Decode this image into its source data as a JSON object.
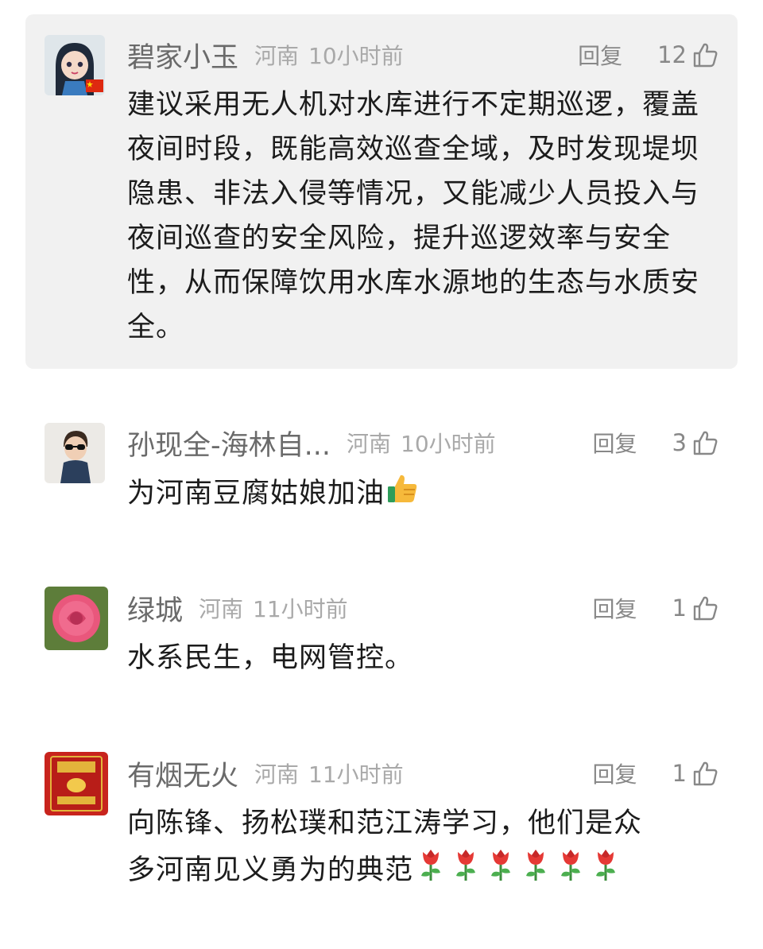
{
  "comments": [
    {
      "username": "碧家小玉",
      "location": "河南",
      "time": "10小时前",
      "reply_label": "回复",
      "likes": "12",
      "text": "建议采用无人机对水库进行不定期巡逻，覆盖夜间时段，既能高效巡查全域，及时发现堤坝隐患、非法入侵等情况，又能减少人员投入与夜间巡查的安全风险，提升巡逻效率与安全性，从而保障饮用水库水源地的生态与水质安全。",
      "avatar_icon": "doll-avatar",
      "badge_icon": "china-flag-icon"
    },
    {
      "username": "孙现全-海林自...",
      "location": "河南",
      "time": "10小时前",
      "reply_label": "回复",
      "likes": "3",
      "text": "为河南豆腐姑娘加油",
      "emoji": "thumbs-up-emoji",
      "avatar_icon": "boy-sunglasses-avatar"
    },
    {
      "username": "绿城",
      "location": "河南",
      "time": "11小时前",
      "reply_label": "回复",
      "likes": "1",
      "text": "水系民生，电网管控。",
      "avatar_icon": "rose-avatar"
    },
    {
      "username": "有烟无火",
      "location": "河南",
      "time": "11小时前",
      "reply_label": "回复",
      "likes": "1",
      "text_line1": "向陈锋、扬松璞和范江涛学习，他们是众",
      "text_line2": "多河南见义勇为的典范",
      "emoji": "rose-emoji",
      "emoji_count": 6,
      "avatar_icon": "cigarette-pack-avatar"
    }
  ],
  "colors": {
    "highlight_bg": "#f1f1f1",
    "username": "#6a6a6a",
    "meta": "#a9a9a9",
    "text": "#1c1c1c"
  }
}
